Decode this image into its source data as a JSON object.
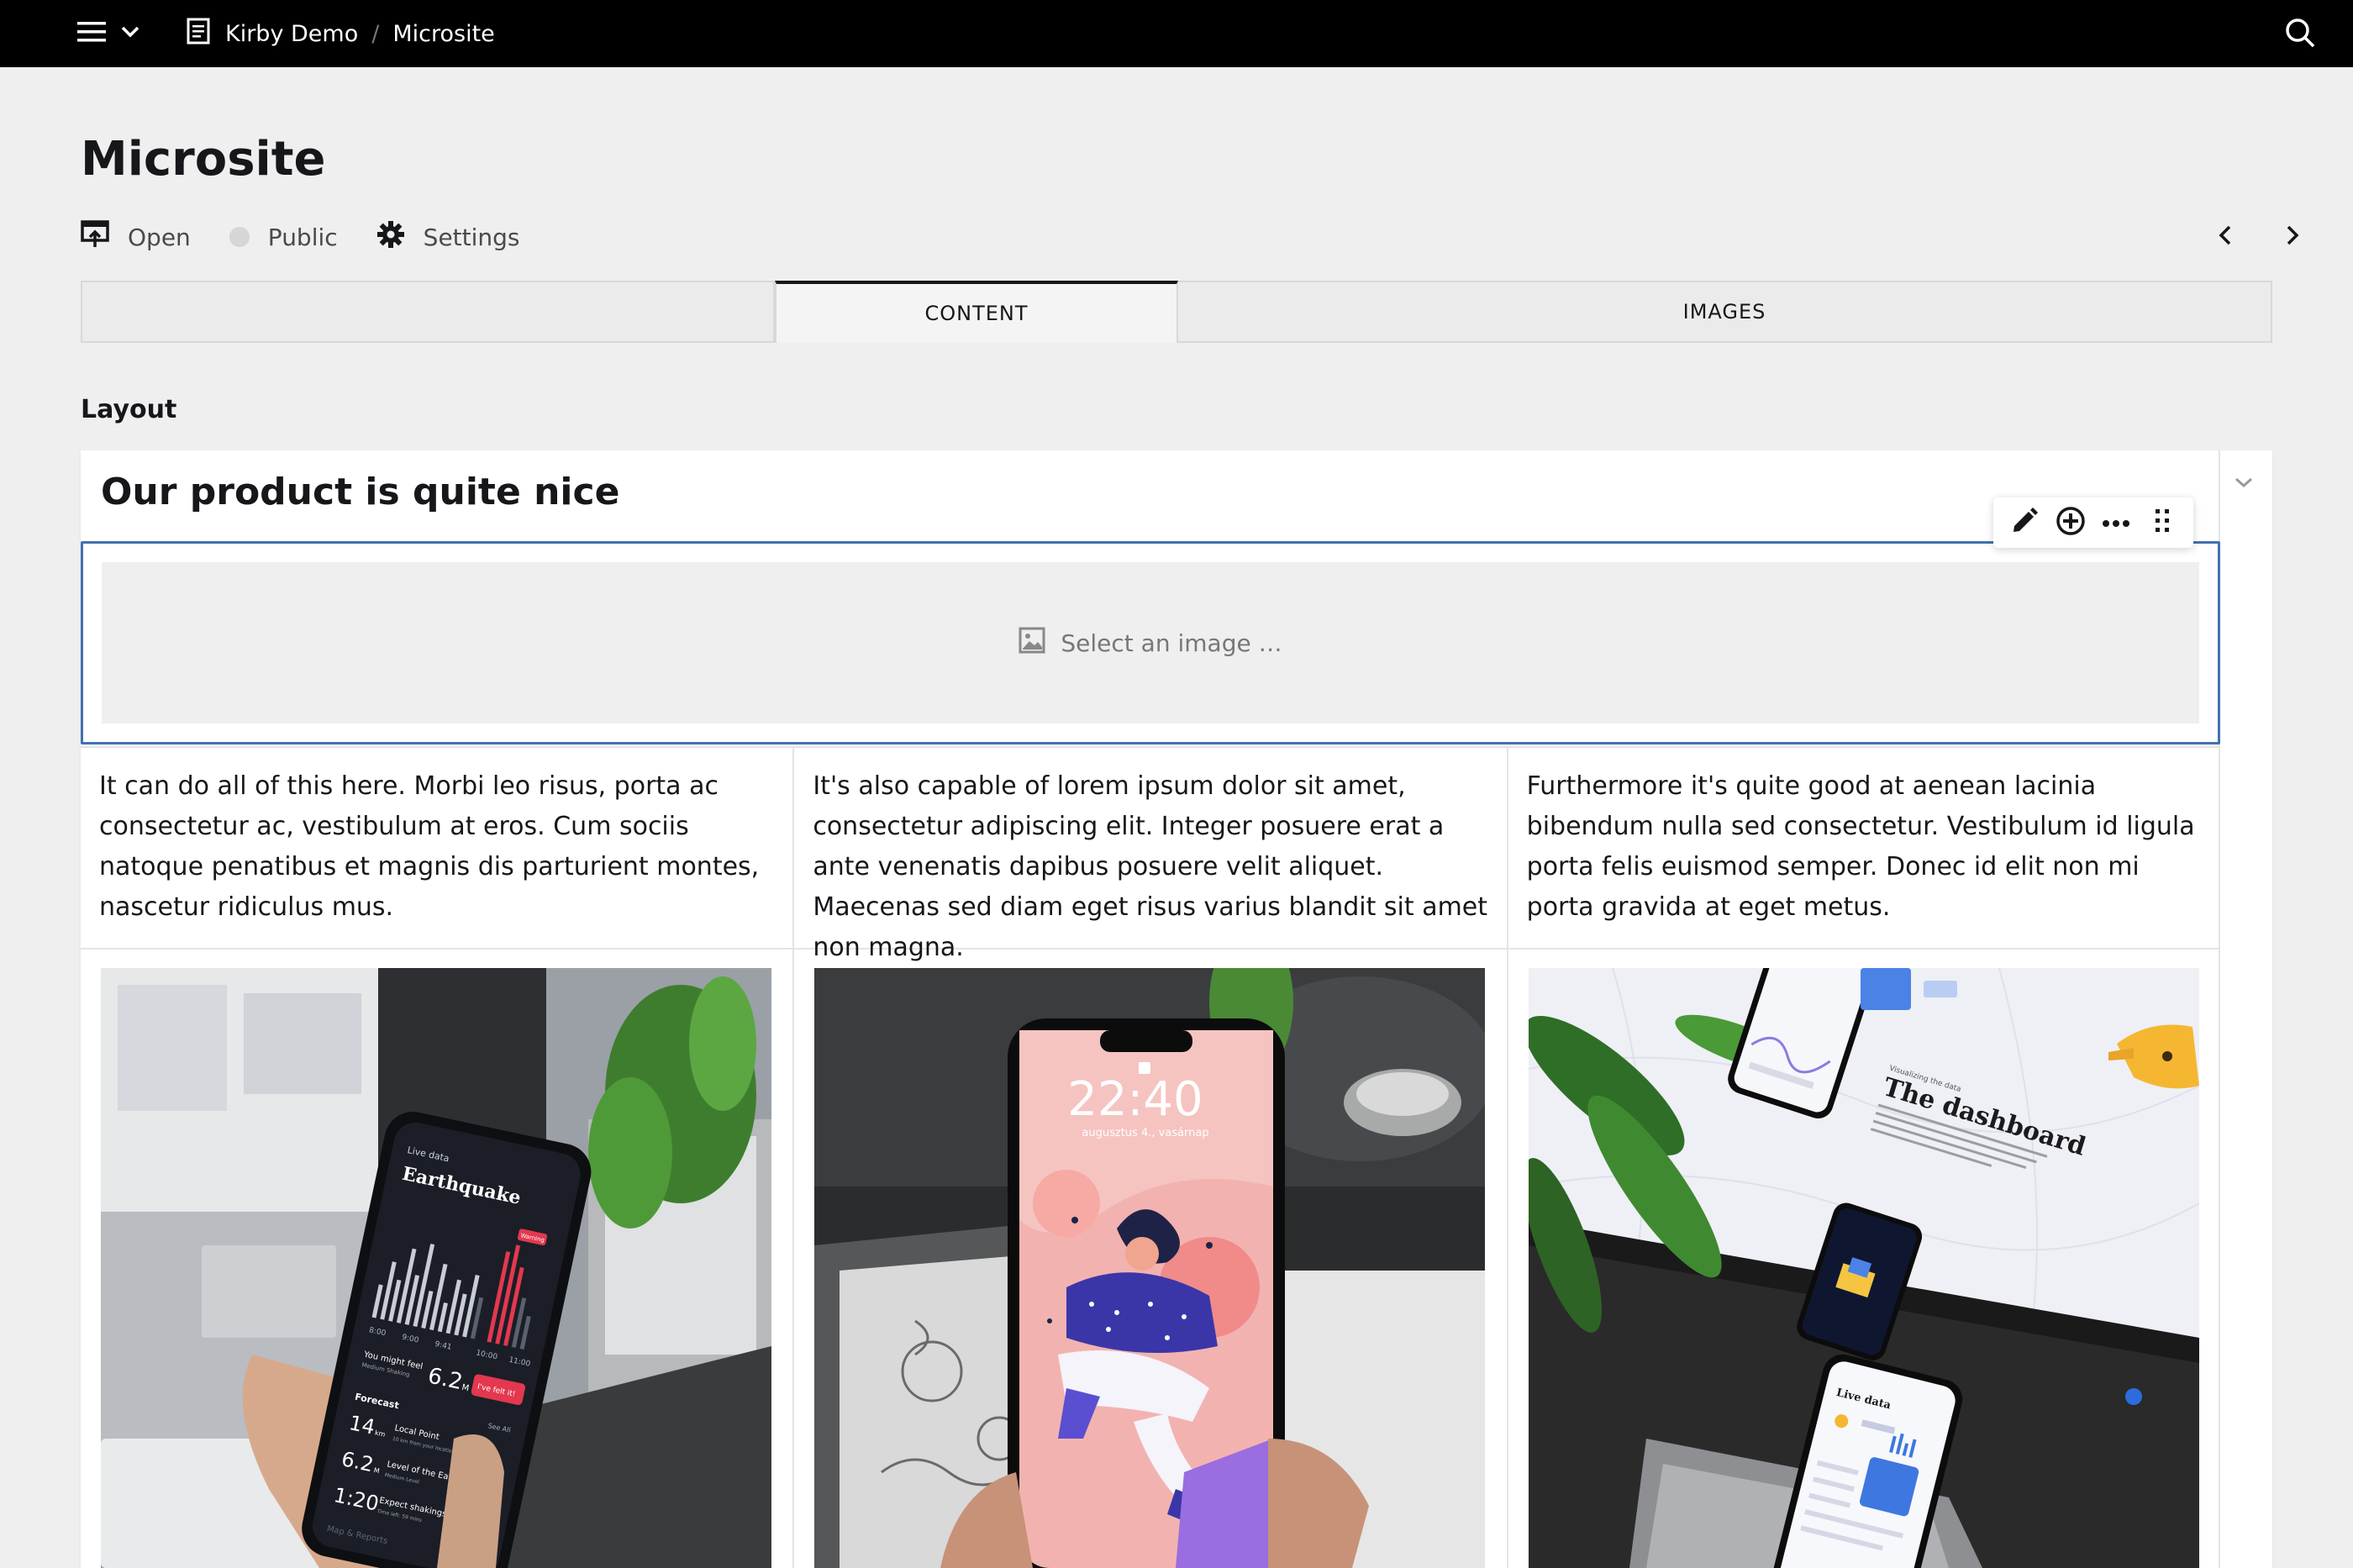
{
  "topbar": {
    "breadcrumbs": [
      {
        "label": "Kirby Demo"
      },
      {
        "label": "Microsite"
      }
    ],
    "separator": "/"
  },
  "header": {
    "title": "Microsite",
    "options": {
      "open": "Open",
      "status": "Public",
      "settings": "Settings"
    }
  },
  "tabs": [
    {
      "label": "CONTENT",
      "active": true
    },
    {
      "label": "IMAGES",
      "active": false
    }
  ],
  "field": {
    "label": "Layout",
    "heading": "Our product is quite nice",
    "image_placeholder": "Select an image …",
    "columns": [
      "It can do all of this here. Morbi leo risus, porta ac consectetur ac, vestibulum at eros. Cum sociis natoque penatibus et magnis dis parturient montes, nascetur ridiculus mus.",
      "It's also capable of lorem ipsum dolor sit amet, consectetur adipiscing elit. Integer posuere erat a ante venenatis dapibus posuere velit aliquet. Maecenas sed diam eget risus varius blandit sit amet non magna.",
      "Furthermore it's quite good at aenean lacinia bibendum nulla sed consectetur. Vestibulum id ligula porta felis euismod semper. Donec id elit non mi porta gravida at eget metus."
    ],
    "photos": [
      {
        "app_back": "Live data",
        "app_title": "Earthquake",
        "app_badge": "Warning",
        "times": [
          "8:00",
          "9:00",
          "9:41",
          "10:00",
          "11:00"
        ],
        "feel_label": "You might feel",
        "feel_sub": "Medium Shaking",
        "feel_value": "6.2",
        "feel_unit": "M",
        "feel_button": "I've felt it!",
        "forecast_label": "Forecast",
        "see_all": "See All",
        "rows": [
          {
            "value": "14",
            "unit": "km",
            "title": "Local Point",
            "sub": "10 km from your location"
          },
          {
            "value": "6.2",
            "unit": "M",
            "title": "Level of the Earthquake",
            "sub": "Medium Level"
          },
          {
            "value": "1:20",
            "unit": "",
            "title": "Expect shakings until",
            "sub": "Time left: 59 mins"
          }
        ],
        "footer": "Map & Reports"
      },
      {
        "lock_time": "22:40",
        "lock_date": "augusztus 4., vasárnap"
      },
      {
        "headline": "The dashboard",
        "kicker": "Visualizing the data",
        "small_screen": "Live data"
      }
    ]
  },
  "colors": {
    "topbar": "#000000",
    "background": "#efefef",
    "focus": "#4271ae",
    "status_dot": "#d6d6d6"
  },
  "icons": [
    "menu-icon",
    "chevron-down-icon",
    "page-icon",
    "search-icon",
    "open-icon",
    "status-dot-icon",
    "gear-icon",
    "chevron-left-icon",
    "chevron-right-icon",
    "collapse-chevron-icon",
    "pencil-icon",
    "add-circle-icon",
    "more-icon",
    "drag-handle-icon",
    "image-icon"
  ]
}
